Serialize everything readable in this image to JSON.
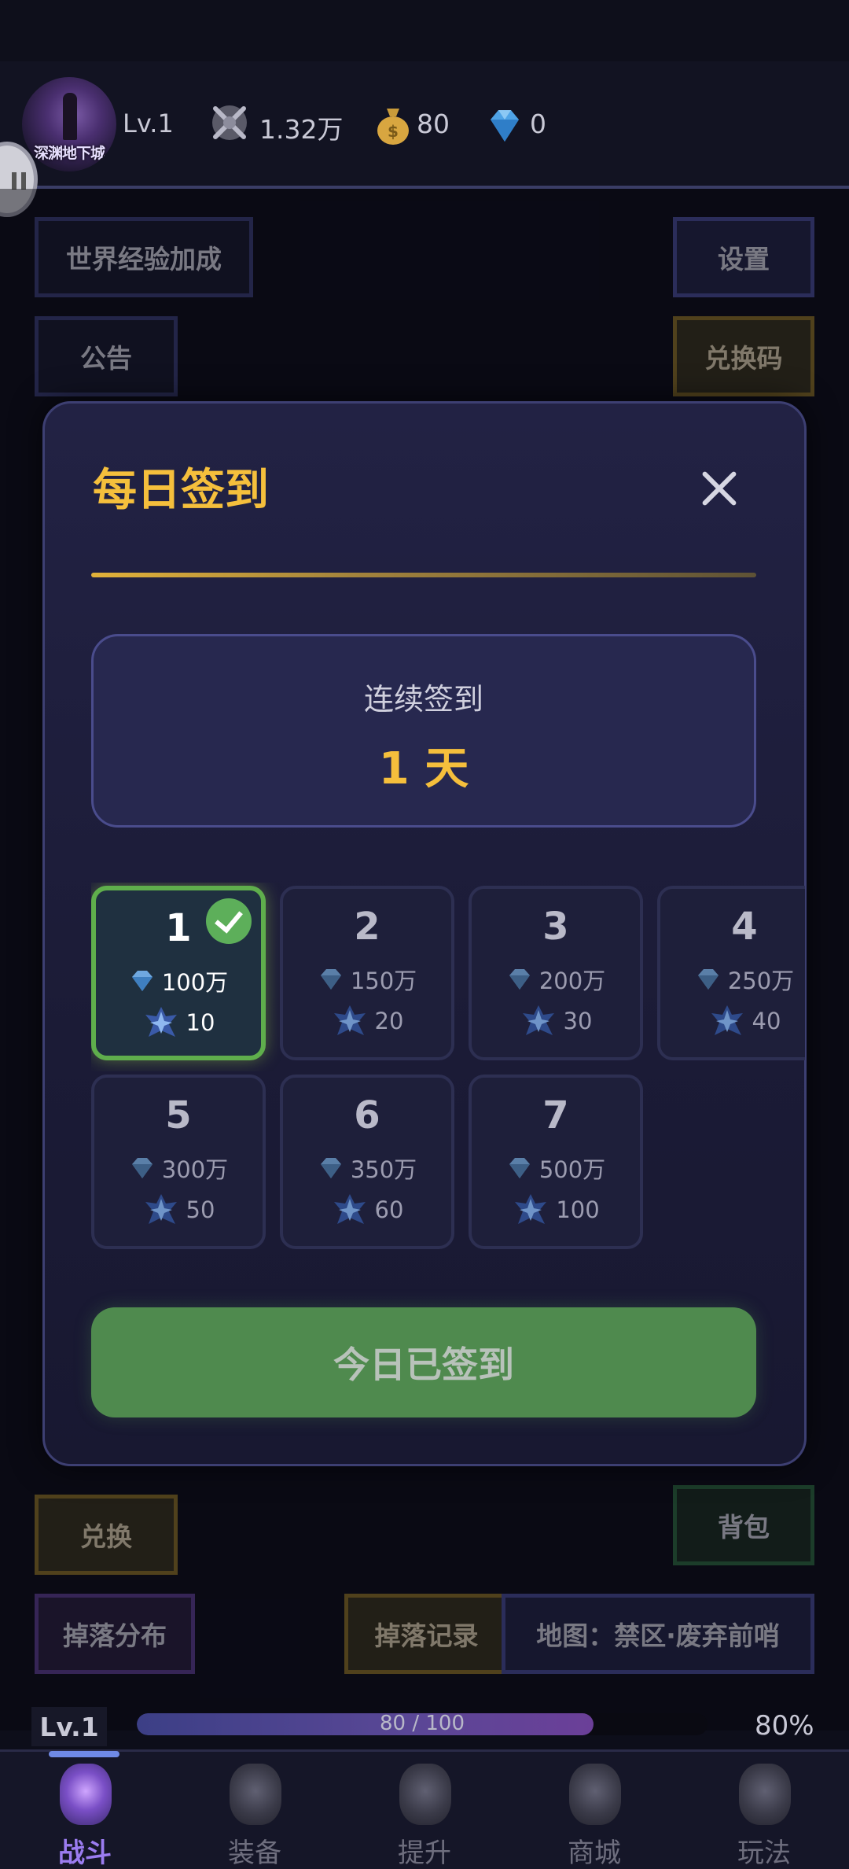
{
  "header": {
    "avatar_text": "深渊地下城",
    "level": "Lv.1",
    "power": "1.32万",
    "gold": "80",
    "diamond": "0"
  },
  "buttons": {
    "world_exp": "世界经验加成",
    "settings": "设置",
    "announcement": "公告",
    "redeem_code": "兑换码",
    "exchange": "兑换",
    "backpack": "背包",
    "drop_distribution": "掉落分布",
    "drop_record": "掉落记录",
    "map": "地图：禁区·废弃前哨"
  },
  "modal": {
    "title": "每日签到",
    "streak_label": "连续签到",
    "streak_value": "1 天",
    "days": [
      {
        "day": "1",
        "diamonds": "100万",
        "crystals": "10",
        "claimed": true
      },
      {
        "day": "2",
        "diamonds": "150万",
        "crystals": "20",
        "claimed": false
      },
      {
        "day": "3",
        "diamonds": "200万",
        "crystals": "30",
        "claimed": false
      },
      {
        "day": "4",
        "diamonds": "250万",
        "crystals": "40",
        "claimed": false
      },
      {
        "day": "5",
        "diamonds": "300万",
        "crystals": "50",
        "claimed": false
      },
      {
        "day": "6",
        "diamonds": "350万",
        "crystals": "60",
        "claimed": false
      },
      {
        "day": "7",
        "diamonds": "500万",
        "crystals": "100",
        "claimed": false
      }
    ],
    "signed_button": "今日已签到"
  },
  "level_bar": {
    "label": "Lv.1",
    "xp_text": "80 / 100",
    "progress": 0.8,
    "percent_text": "80%"
  },
  "nav": {
    "items": [
      {
        "label": "战斗",
        "active": true
      },
      {
        "label": "装备",
        "active": false
      },
      {
        "label": "提升",
        "active": false
      },
      {
        "label": "商城",
        "active": false
      },
      {
        "label": "玩法",
        "active": false
      }
    ]
  },
  "colors": {
    "accent_gold": "#f5bf3c",
    "claimed_green": "#5fae4c",
    "nav_active": "#9b7cf0"
  }
}
